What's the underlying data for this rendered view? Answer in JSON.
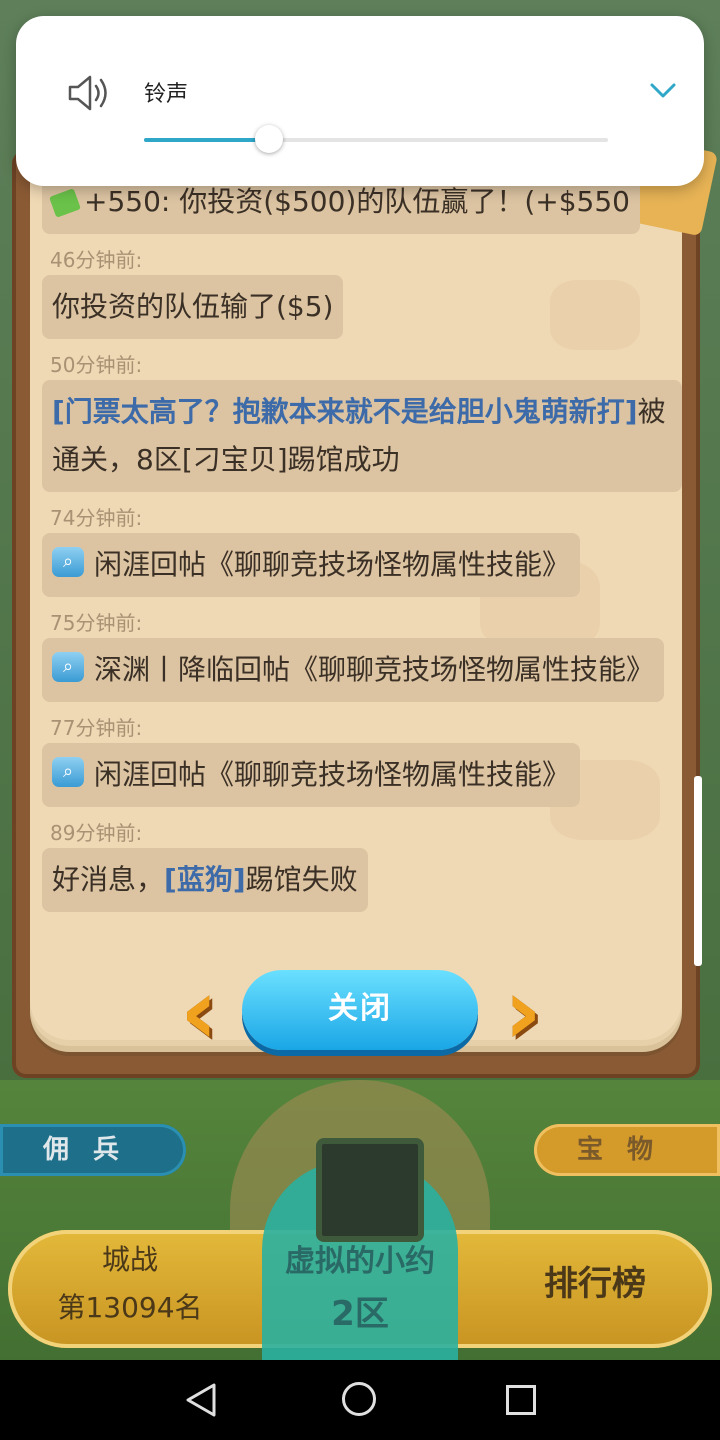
{
  "volume_dialog": {
    "label": "铃声",
    "level": 0.27,
    "accent": "#2ea7c9"
  },
  "feed": [
    {
      "time": "",
      "icon": "money-icon",
      "parts": [
        {
          "text": "+550: 你投资($500)的队伍赢了！(+$550",
          "hl": false
        }
      ]
    },
    {
      "time": "46分钟前:",
      "icon": "",
      "parts": [
        {
          "text": "你投资的队伍输了($5)",
          "hl": false
        }
      ]
    },
    {
      "time": "50分钟前:",
      "icon": "",
      "parts": [
        {
          "text": "[门票太高了？抱歉本来就不是给胆小鬼萌新打]",
          "hl": true
        },
        {
          "text": "被通关，8区[刁宝贝]踢馆成功",
          "hl": false
        }
      ]
    },
    {
      "time": "74分钟前:",
      "icon": "search-icon",
      "parts": [
        {
          "text": "闲涯回帖《聊聊竞技场怪物属性技能》",
          "hl": false
        }
      ]
    },
    {
      "time": "75分钟前:",
      "icon": "search-icon",
      "parts": [
        {
          "text": "深渊丨降临回帖《聊聊竞技场怪物属性技能》",
          "hl": false
        }
      ]
    },
    {
      "time": "77分钟前:",
      "icon": "search-icon",
      "parts": [
        {
          "text": "闲涯回帖《聊聊竞技场怪物属性技能》",
          "hl": false
        }
      ]
    },
    {
      "time": "89分钟前:",
      "icon": "",
      "parts": [
        {
          "text": "好消息，",
          "hl": false
        },
        {
          "text": "[蓝狗]",
          "hl": true
        },
        {
          "text": "踢馆失败",
          "hl": false
        }
      ]
    }
  ],
  "close_button": "关闭",
  "hud": {
    "left_tab": "佣兵",
    "right_tab": "宝物",
    "city_war_title": "城战",
    "city_war_rank": "第13094名",
    "user_name": "虚拟的小约",
    "server": "2区",
    "leaderboard": "排行榜"
  }
}
